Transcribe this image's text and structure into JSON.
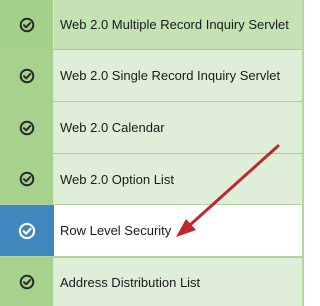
{
  "list": {
    "items": [
      {
        "label": "Web 2.0 Multiple Record Inquiry Servlet",
        "icon": "check-circle-icon",
        "state": "normal"
      },
      {
        "label": "Web 2.0 Single Record Inquiry Servlet",
        "icon": "check-circle-icon",
        "state": "normal"
      },
      {
        "label": "Web 2.0 Calendar",
        "icon": "check-circle-icon",
        "state": "normal"
      },
      {
        "label": "Web 2.0 Option List",
        "icon": "check-circle-icon",
        "state": "normal"
      },
      {
        "label": "Row Level Security",
        "icon": "check-circle-icon",
        "state": "selected"
      },
      {
        "label": "Address Distribution List",
        "icon": "check-circle-icon",
        "state": "normal"
      }
    ]
  },
  "colors": {
    "row_background": "#dfeed8",
    "icon_cell_background": "#a6d28d",
    "selected_icon_cell_background": "#3f87bd",
    "selected_row_background": "#ffffff",
    "annotation_arrow": "#c0262c"
  }
}
